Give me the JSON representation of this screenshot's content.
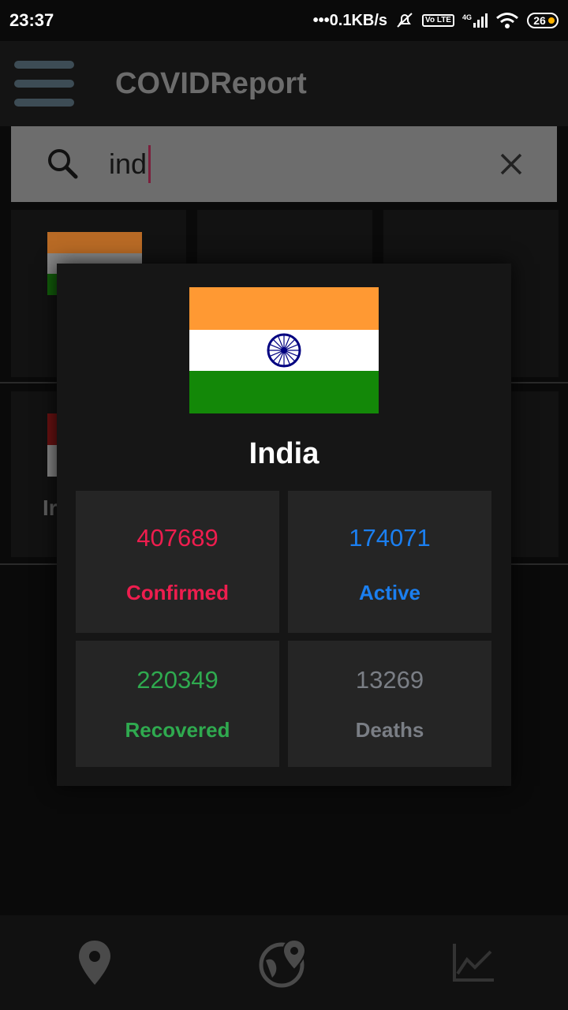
{
  "status_bar": {
    "time": "23:37",
    "network_speed": "•••0.1KB/s",
    "network_type": "4G",
    "volte": "Vo LTE",
    "battery": "26"
  },
  "app": {
    "title": "COVIDReport"
  },
  "search": {
    "query": "ind",
    "icon": "search-icon",
    "clear_icon": "close-icon"
  },
  "background": {
    "partial_label": "Ir"
  },
  "dialog": {
    "country": "India",
    "flag": {
      "colors": {
        "saffron": "#FF9933",
        "white": "#FFFFFF",
        "green": "#138808",
        "chakra": "#000080"
      }
    },
    "stats": {
      "confirmed": {
        "value": "407689",
        "label": "Confirmed",
        "color": "#ee1d4e"
      },
      "active": {
        "value": "174071",
        "label": "Active",
        "color": "#1b7ff0"
      },
      "recovered": {
        "value": "220349",
        "label": "Recovered",
        "color": "#2faa4f"
      },
      "deaths": {
        "value": "13269",
        "label": "Deaths",
        "color": "#7a7e85"
      }
    }
  },
  "bottom_nav": {
    "items": [
      {
        "name": "location",
        "icon": "location-pin-icon"
      },
      {
        "name": "world",
        "icon": "globe-pin-icon"
      },
      {
        "name": "chart",
        "icon": "line-chart-icon"
      }
    ]
  }
}
